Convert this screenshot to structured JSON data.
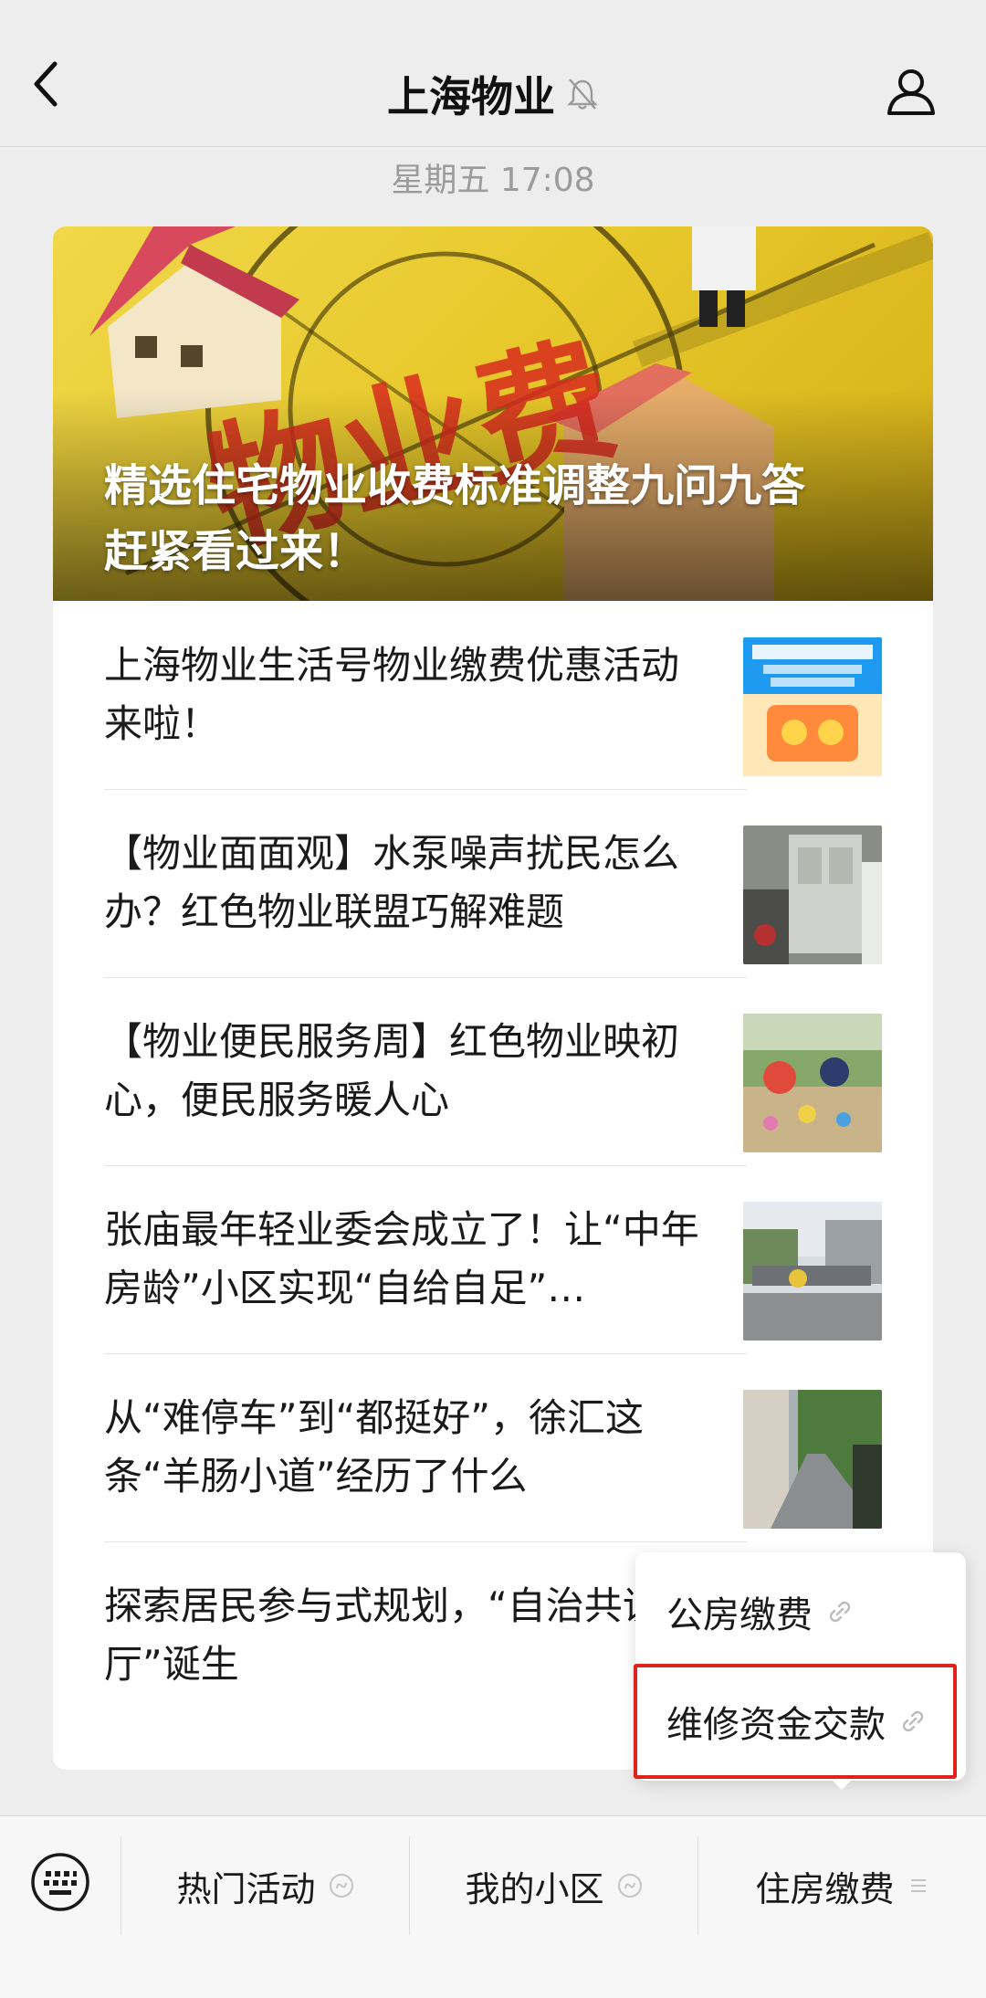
{
  "header": {
    "title": "上海物业"
  },
  "timestamp": "星期五 17:08",
  "hero": {
    "title": "精选住宅物业收费标准调整九问九答\n赶紧看过来！"
  },
  "articles": [
    {
      "title": "上海物业生活号物业缴费优惠活动来啦！"
    },
    {
      "title": "【物业面面观】水泵噪声扰民怎么办？红色物业联盟巧解难题"
    },
    {
      "title": "【物业便民服务周】红色物业映初心，便民服务暖人心"
    },
    {
      "title": "张庙最年轻业委会成立了！让“中年房龄”小区实现“自给自足”…"
    },
    {
      "title": "从“难停车”到“都挺好”，徐汇这条“羊肠小道”经历了什么"
    },
    {
      "title": "探索居民参与式规划，“自治共议事厅”诞生"
    }
  ],
  "popup": {
    "items": [
      {
        "label": "公房缴费"
      },
      {
        "label": "维修资金交款"
      }
    ]
  },
  "bottombar": {
    "items": [
      {
        "label": "热门活动"
      },
      {
        "label": "我的小区"
      },
      {
        "label": "住房缴费"
      }
    ]
  },
  "colors": {
    "highlight": "#e0231c",
    "background": "#ededed"
  }
}
